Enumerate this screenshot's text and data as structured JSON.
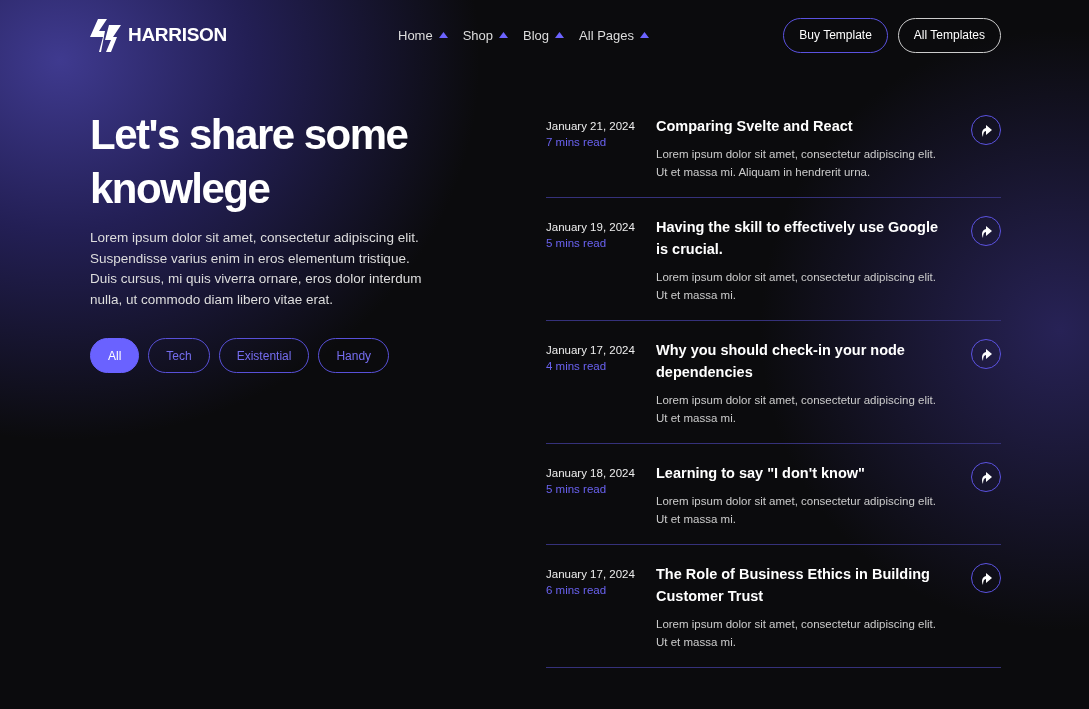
{
  "brand": {
    "name": "HARRISON"
  },
  "nav": [
    {
      "label": "Home"
    },
    {
      "label": "Shop"
    },
    {
      "label": "Blog"
    },
    {
      "label": "All Pages"
    }
  ],
  "header_buttons": [
    {
      "label": "Buy Template",
      "kind": "accent"
    },
    {
      "label": "All Templates",
      "kind": "plain"
    }
  ],
  "hero": {
    "title": "Let's share some knowlege",
    "text": "Lorem ipsum dolor sit amet, consectetur adipiscing elit. Suspendisse varius enim in eros elementum tristique. Duis cursus, mi quis viverra ornare, eros dolor interdum nulla, ut commodo diam libero vitae erat."
  },
  "filters": [
    {
      "label": "All",
      "selected": true
    },
    {
      "label": "Tech",
      "selected": false
    },
    {
      "label": "Existential",
      "selected": false
    },
    {
      "label": "Handy",
      "selected": false
    }
  ],
  "posts": [
    {
      "date": "January 21, 2024",
      "read_time": "7 mins read",
      "title": "Comparing Svelte and React",
      "excerpt": "Lorem ipsum dolor sit amet, consectetur adipiscing elit. Ut et massa mi. Aliquam in hendrerit urna."
    },
    {
      "date": "January 19, 2024",
      "read_time": "5 mins read",
      "title": "Having the skill to effectively use Google is crucial.",
      "excerpt": "Lorem ipsum dolor sit amet, consectetur adipiscing elit. Ut et massa mi."
    },
    {
      "date": "January 17, 2024",
      "read_time": "4 mins read",
      "title": "Why you should check-in your node dependencies",
      "excerpt": "Lorem ipsum dolor sit amet, consectetur adipiscing elit. Ut et massa mi."
    },
    {
      "date": "January 18, 2024",
      "read_time": "5 mins read",
      "title": "Learning to say \"I don't know\"",
      "excerpt": "Lorem ipsum dolor sit amet, consectetur adipiscing elit. Ut et massa mi."
    },
    {
      "date": "January 17, 2024",
      "read_time": "6 mins read",
      "title": "The Role of Business Ethics in Building Customer Trust",
      "excerpt": "Lorem ipsum dolor sit amet, consectetur adipiscing elit. Ut et massa mi."
    }
  ]
}
